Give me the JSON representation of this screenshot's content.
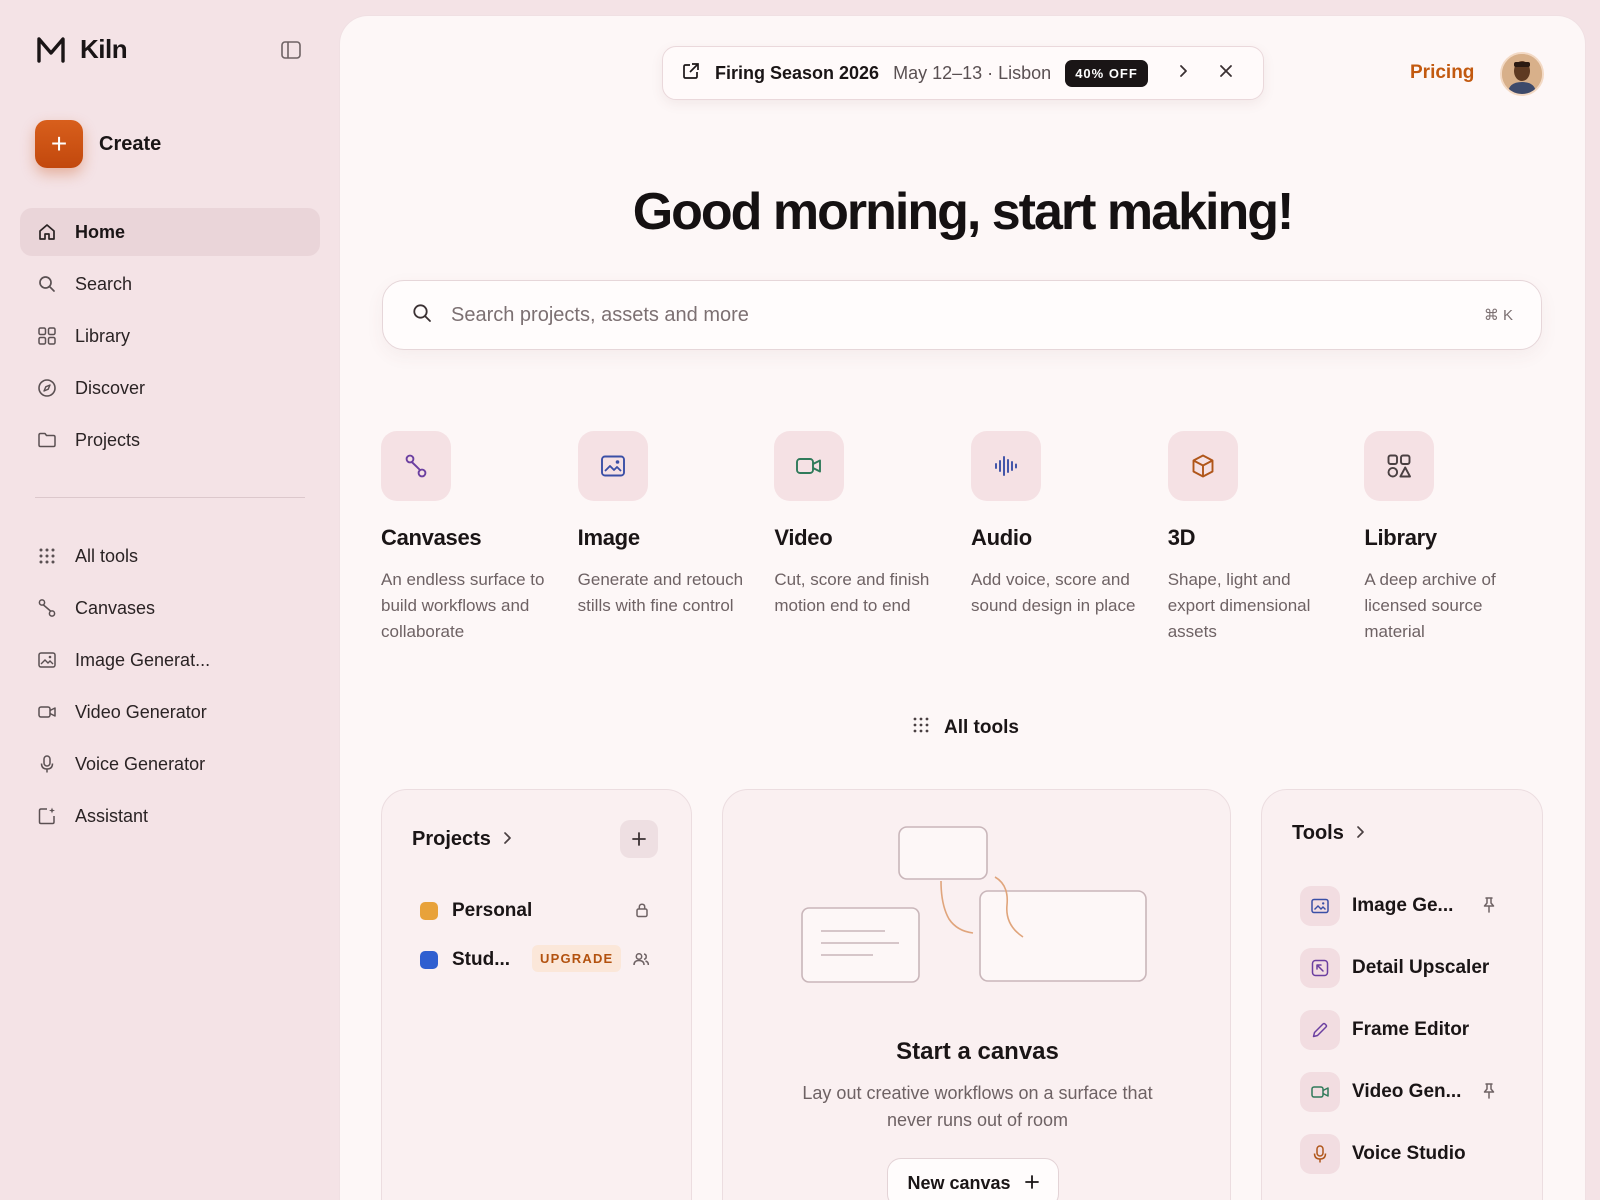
{
  "app": {
    "name": "Kiln"
  },
  "sidebar": {
    "create_label": "Create",
    "primary": [
      {
        "label": "Home",
        "icon": "home-icon",
        "active": true
      },
      {
        "label": "Search",
        "icon": "search-icon"
      },
      {
        "label": "Library",
        "icon": "grid-icon"
      },
      {
        "label": "Discover",
        "icon": "compass-icon"
      },
      {
        "label": "Projects",
        "icon": "folder-icon"
      }
    ],
    "secondary": [
      {
        "label": "All tools",
        "icon": "dots-grid-icon"
      },
      {
        "label": "Canvases",
        "icon": "canvas-icon"
      },
      {
        "label": "Image Generat...",
        "icon": "image-icon"
      },
      {
        "label": "Video Generator",
        "icon": "video-icon"
      },
      {
        "label": "Voice Generator",
        "icon": "microphone-icon"
      },
      {
        "label": "Assistant",
        "icon": "sparkle-edit-icon"
      }
    ]
  },
  "promo": {
    "title": "Firing Season 2026",
    "meta": "May 12–13 · Lisbon",
    "badge": "40% OFF"
  },
  "header": {
    "pricing_label": "Pricing"
  },
  "greeting": "Good morning, start making!",
  "search": {
    "placeholder": "Search projects, assets and more",
    "shortcut": "⌘ K"
  },
  "categories": [
    {
      "title": "Canvases",
      "desc": "An endless surface to build workflows and collaborate",
      "icon": "canvas-icon",
      "color": "#6b3fa0"
    },
    {
      "title": "Image",
      "desc": "Generate and retouch stills with fine control",
      "icon": "image-icon",
      "color": "#3a4fa6"
    },
    {
      "title": "Video",
      "desc": "Cut, score and finish motion end to end",
      "icon": "video-icon",
      "color": "#2f7a5a"
    },
    {
      "title": "Audio",
      "desc": "Add voice, score and sound design in place",
      "icon": "waveform-icon",
      "color": "#3a4fa6"
    },
    {
      "title": "3D",
      "desc": "Shape, light and export dimensional assets",
      "icon": "cube-icon",
      "color": "#b0561a"
    },
    {
      "title": "Library",
      "desc": "A deep archive of licensed source material",
      "icon": "shapes-icon",
      "color": "#5a5052"
    }
  ],
  "all_tools_label": "All tools",
  "projects_card": {
    "title": "Projects",
    "items": [
      {
        "name": "Personal",
        "color": "#e8a23a",
        "icon": "lock-icon"
      },
      {
        "name": "Stud...",
        "color": "#2f5fd0",
        "badge": "UPGRADE",
        "icon": "users-icon"
      }
    ]
  },
  "canvas_card": {
    "title": "Start a canvas",
    "desc": "Lay out creative workflows on a surface that never runs out of room",
    "button_label": "New canvas"
  },
  "tools_card": {
    "title": "Tools",
    "items": [
      {
        "name": "Image Ge...",
        "icon": "image-icon",
        "pinned": true,
        "color": "#3a4fa6"
      },
      {
        "name": "Detail Upscaler",
        "icon": "upscale-icon",
        "pinned": false,
        "color": "#6b3fa0"
      },
      {
        "name": "Frame Editor",
        "icon": "pencil-icon",
        "pinned": false,
        "color": "#6b3fa0"
      },
      {
        "name": "Video Gen...",
        "icon": "video-icon",
        "pinned": true,
        "color": "#2f7a5a"
      },
      {
        "name": "Voice Studio",
        "icon": "microphone-icon",
        "pinned": false,
        "color": "#b0561a"
      }
    ]
  }
}
